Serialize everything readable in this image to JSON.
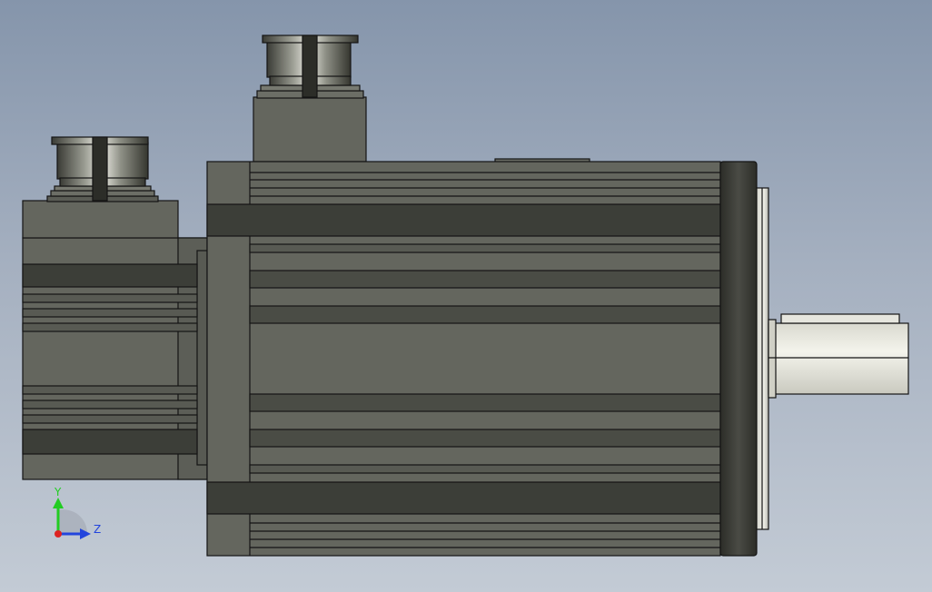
{
  "viewport": {
    "background_top": "#8595ab",
    "background_bottom": "#c3cbd5"
  },
  "model": {
    "body_color": "#64665e",
    "dark_band_color": "#3c3e38",
    "edge_color": "#141414",
    "shaft_color": "#e6e6de"
  },
  "triad": {
    "y_label": "Y",
    "z_label": "Z",
    "y_color": "#22cc22",
    "z_color": "#2244dd",
    "x_color": "#dd2222"
  }
}
